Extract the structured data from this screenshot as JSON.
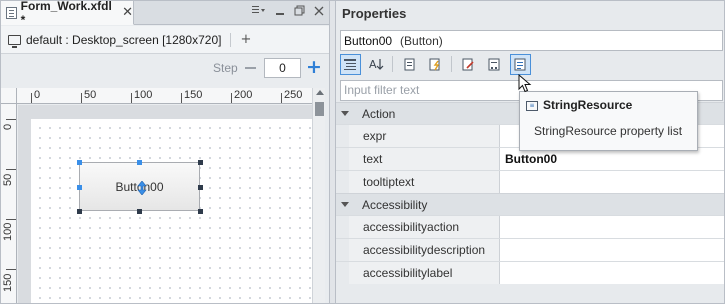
{
  "editor": {
    "tab_label": "Form_Work.xfdl *",
    "tab_close": "✕",
    "screen_label": "default : Desktop_screen [1280x720]",
    "screen_add": "+",
    "step_label": "Step",
    "step_value": "0",
    "ruler_h": [
      "0",
      "50",
      "100",
      "150",
      "200",
      "250"
    ],
    "ruler_v": [
      "0",
      "50",
      "100",
      "150"
    ],
    "button_text": "Button00"
  },
  "properties": {
    "title": "Properties",
    "selected_name": "Button00",
    "selected_type": "(Button)",
    "filter_placeholder": "Input filter text",
    "groups": [
      {
        "name": "Action",
        "rows": [
          {
            "name": "expr",
            "value": ""
          },
          {
            "name": "text",
            "value": "Button00"
          },
          {
            "name": "tooltiptext",
            "value": ""
          }
        ]
      },
      {
        "name": "Accessibility",
        "rows": [
          {
            "name": "accessibilityaction",
            "value": ""
          },
          {
            "name": "accessibilitydescription",
            "value": ""
          },
          {
            "name": "accessibilitylabel",
            "value": ""
          }
        ]
      }
    ]
  },
  "tooltip": {
    "title": "StringResource",
    "body": "StringResource property list"
  },
  "colors": {
    "accent": "#2f7fd6",
    "selection_handle": "#3a8fe8",
    "active_tool": "#cfe3f7"
  },
  "icons": [
    "document-icon",
    "close-icon",
    "monitor-icon",
    "minus-icon",
    "plus-icon",
    "categorized-icon",
    "sort-az-icon",
    "page-icon",
    "event-icon",
    "edit-icon",
    "bind-icon",
    "string-resource-icon",
    "cursor-icon",
    "move-icon"
  ]
}
